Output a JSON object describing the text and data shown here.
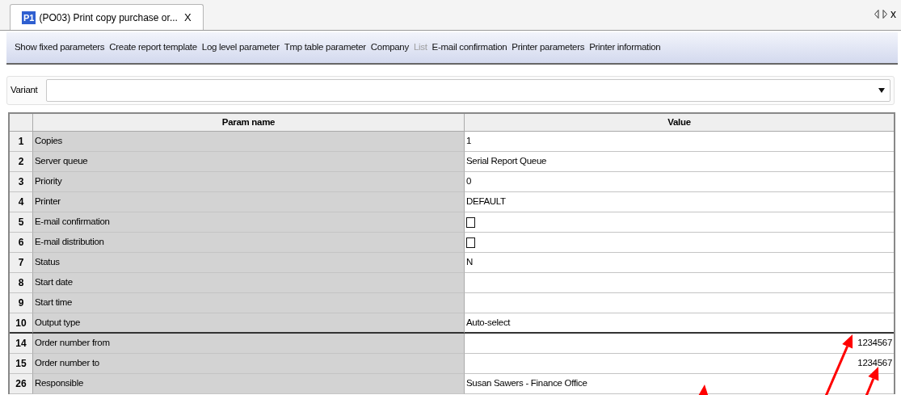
{
  "tab": {
    "icon_text": "P1",
    "title": "(PO03) Print copy purchase or...",
    "close": "X",
    "selected": true
  },
  "tab_nav": {
    "close": "x"
  },
  "toolbar": [
    {
      "label": "Show fixed parameters",
      "disabled": false
    },
    {
      "label": "Create report template",
      "disabled": false
    },
    {
      "label": "Log level parameter",
      "disabled": false
    },
    {
      "label": "Tmp table parameter",
      "disabled": false
    },
    {
      "label": "Company",
      "disabled": false
    },
    {
      "label": "List",
      "disabled": true
    },
    {
      "label": "E-mail confirmation",
      "disabled": false
    },
    {
      "label": "Printer parameters",
      "disabled": false
    },
    {
      "label": "Printer information",
      "disabled": false
    }
  ],
  "variant": {
    "label": "Variant"
  },
  "table": {
    "columns": [
      "Param name",
      "Value"
    ],
    "rows": [
      {
        "number": "1",
        "name": "Copies",
        "kind": "text",
        "value": "1",
        "divider_after": false
      },
      {
        "number": "2",
        "name": "Server queue",
        "kind": "text",
        "value": "Serial Report Queue",
        "divider_after": false
      },
      {
        "number": "3",
        "name": "Priority",
        "kind": "text",
        "value": "0",
        "divider_after": false
      },
      {
        "number": "4",
        "name": "Printer",
        "kind": "text",
        "value": "DEFAULT",
        "divider_after": false
      },
      {
        "number": "5",
        "name": "E-mail confirmation",
        "kind": "checkbox",
        "checked": false,
        "divider_after": false
      },
      {
        "number": "6",
        "name": "E-mail distribution",
        "kind": "checkbox",
        "checked": false,
        "divider_after": false
      },
      {
        "number": "7",
        "name": "Status",
        "kind": "text",
        "value": "N",
        "divider_after": false
      },
      {
        "number": "8",
        "name": "Start date",
        "kind": "text",
        "divider_after": false
      },
      {
        "number": "9",
        "name": "Start time",
        "kind": "text",
        "divider_after": false
      },
      {
        "number": "10",
        "name": "Output type",
        "kind": "text",
        "value": "Auto-select",
        "divider_after": true
      },
      {
        "number": "14",
        "name": "Order number from",
        "kind": "number",
        "value": "1234567",
        "divider_after": false
      },
      {
        "number": "15",
        "name": "Order number to",
        "kind": "number",
        "value": "1234567",
        "divider_after": false
      },
      {
        "number": "26",
        "name": "Responsible",
        "kind": "text",
        "value": "Susan Sawers - Finance Office",
        "divider_after": false
      }
    ]
  },
  "annotations": [
    {
      "kind": "arrow"
    },
    {
      "kind": "arrow"
    },
    {
      "kind": "arrow"
    }
  ]
}
